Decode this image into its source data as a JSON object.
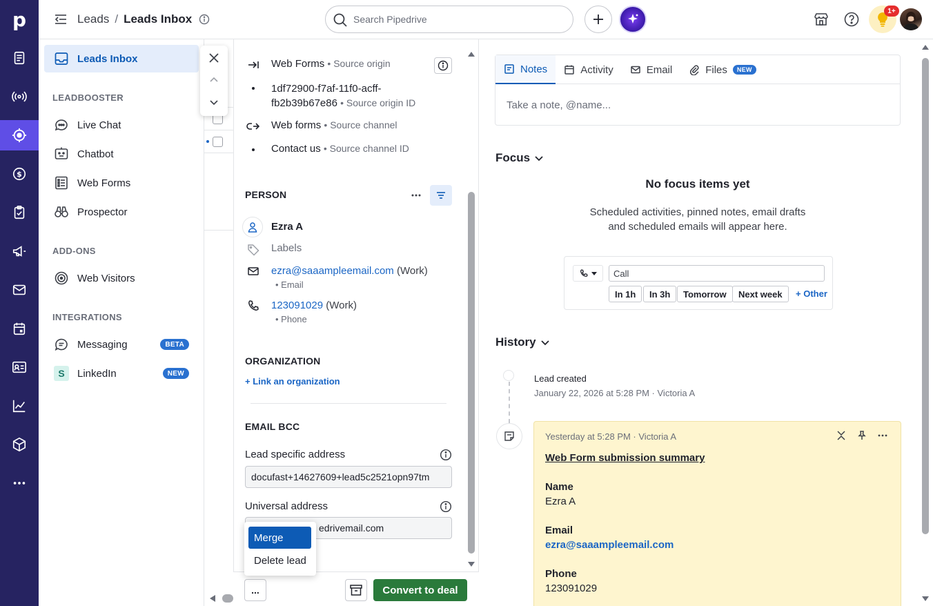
{
  "app": {
    "logo": "p",
    "breadcrumb": {
      "parent": "Leads",
      "separator": "/",
      "current": "Leads Inbox"
    },
    "search_placeholder": "Search Pipedrive",
    "notification_count": "1+"
  },
  "subnav": {
    "active_item": "Leads Inbox",
    "sections": {
      "leadbooster": "LEADBOOSTER",
      "addons": "ADD-ONS",
      "integrations": "INTEGRATIONS"
    },
    "items": {
      "leads_inbox": "Leads Inbox",
      "live_chat": "Live Chat",
      "chatbot": "Chatbot",
      "web_forms": "Web Forms",
      "prospector": "Prospector",
      "web_visitors": "Web Visitors",
      "messaging": "Messaging",
      "linkedin": "LinkedIn"
    },
    "badges": {
      "messaging": "BETA",
      "linkedin": "NEW"
    }
  },
  "detail": {
    "source": {
      "origin": "Web Forms",
      "origin_label": "• Source origin",
      "origin_id_line1": "1df72900-f7af-11f0-acff-",
      "origin_id_line2": "fb2b39b67e86",
      "origin_id_label": "• Source origin ID",
      "channel": "Web forms",
      "channel_label": "• Source channel",
      "channel_id": "Contact us",
      "channel_id_label": "• Source channel ID"
    },
    "person": {
      "section": "PERSON",
      "name": "Ezra A",
      "labels_placeholder": "Labels",
      "email": "ezra@saaampleemail.com",
      "email_type": "(Work)",
      "email_label": "• Email",
      "phone": "123091029",
      "phone_type": "(Work)",
      "phone_label": "• Phone"
    },
    "organization": {
      "section": "ORGANIZATION",
      "link": "+ Link an organization"
    },
    "email_bcc": {
      "section": "EMAIL BCC",
      "lead_specific_label": "Lead specific address",
      "lead_specific_value": "docufast+14627609+lead5c2521opn97tm",
      "universal_label": "Universal address",
      "universal_value": "edrivemail.com"
    },
    "footer": {
      "more": "...",
      "convert": "Convert to deal"
    },
    "dropdown": {
      "merge": "Merge",
      "delete": "Delete lead"
    }
  },
  "right": {
    "tabs": {
      "notes": "Notes",
      "activity": "Activity",
      "email": "Email",
      "files": "Files",
      "files_badge": "NEW"
    },
    "note_placeholder": "Take a note, @name...",
    "focus": {
      "title": "Focus",
      "empty_title": "No focus items yet",
      "empty_line1": "Scheduled activities, pinned notes, email drafts",
      "empty_line2": "and scheduled emails will appear here.",
      "call_placeholder": "Call",
      "quick": {
        "in1h": "In 1h",
        "in3h": "In 3h",
        "tomorrow": "Tomorrow",
        "next_week": "Next week",
        "other": "+ Other"
      }
    },
    "history": {
      "title": "History",
      "created_title": "Lead created",
      "created_meta": "January 22, 2026 at 5:28 PM · Victoria A",
      "note": {
        "meta": "Yesterday at 5:28 PM · Victoria A",
        "heading": "Web Form submission summary",
        "name_label": "Name",
        "name_value": "Ezra A",
        "email_label": "Email",
        "email_value": "ezra@saaampleemail.com",
        "phone_label": "Phone",
        "phone_value": "123091029"
      }
    }
  },
  "colors": {
    "rail": "#262361",
    "rail_active": "#5f4ee6",
    "link": "#1b66c5",
    "convert": "#2a7a3b",
    "note_bg": "#fef5cf"
  }
}
